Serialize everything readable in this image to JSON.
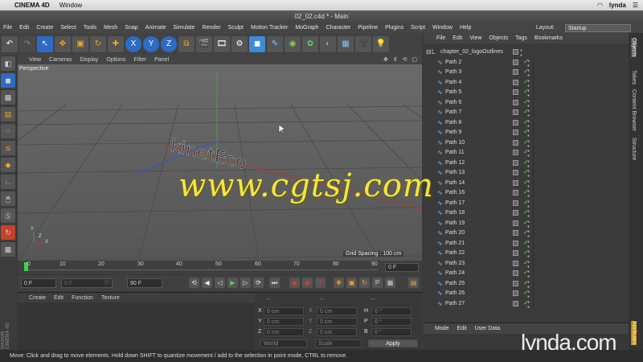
{
  "macmenu": {
    "app": "CINEMA 4D",
    "window": "Window",
    "user": "lynda"
  },
  "window_title": "02_02.c4d * - Main",
  "menubar": [
    "File",
    "Edit",
    "Create",
    "Select",
    "Tools",
    "Mesh",
    "Snap",
    "Animate",
    "Simulate",
    "Render",
    "Sculpt",
    "Motion Tracker",
    "MoGraph",
    "Character",
    "Pipeline",
    "Plugins",
    "Script",
    "Window",
    "Help"
  ],
  "layout": {
    "label": "Layout:",
    "value": "Startup"
  },
  "view_menu": [
    "View",
    "Cameras",
    "Display",
    "Options",
    "Filter",
    "Panel"
  ],
  "viewport": {
    "label": "Perspective",
    "grid_spacing": "Grid Spacing : 100 cm",
    "logo_text": "kinetEco"
  },
  "timeline": {
    "ticks": [
      "0",
      "10",
      "20",
      "30",
      "40",
      "50",
      "60",
      "70",
      "80",
      "90"
    ],
    "end_field": "0 F"
  },
  "transport": {
    "current": "0 F",
    "min": "0 F",
    "min_val": "90 F",
    "max": "90 F"
  },
  "material_menu": [
    "Create",
    "Edit",
    "Function",
    "Texture"
  ],
  "coords": {
    "headers": [
      "--",
      "--",
      "--"
    ],
    "rows": [
      {
        "axis": "X",
        "pos": "0 cm",
        "size": "0 cm",
        "rlabel": "H",
        "rot": "0 °"
      },
      {
        "axis": "Y",
        "pos": "0 cm",
        "size": "0 cm",
        "rlabel": "P",
        "rot": "0 °"
      },
      {
        "axis": "Z",
        "pos": "0 cm",
        "size": "0 cm",
        "rlabel": "B",
        "rot": "0 °"
      }
    ],
    "world": "World",
    "scale": "Scale",
    "apply": "Apply"
  },
  "objects": {
    "menu": [
      "File",
      "Edit",
      "View",
      "Objects",
      "Tags",
      "Bookmarks"
    ],
    "root": "chapter_02_logoOutlines",
    "items": [
      "Path 2",
      "Path 3",
      "Path 4",
      "Path 5",
      "Path 6",
      "Path 7",
      "Path 8",
      "Path 9",
      "Path 10",
      "Path 11",
      "Path 12",
      "Path 13",
      "Path 14",
      "Path 16",
      "Path 17",
      "Path 18",
      "Path 19",
      "Path 20",
      "Path 21",
      "Path 22",
      "Path 23",
      "Path 24",
      "Path 25",
      "Path 26",
      "Path 27"
    ]
  },
  "attributes_menu": [
    "Mode",
    "Edit",
    "User Data"
  ],
  "side_tabs": [
    "Objects",
    "Takes",
    "Content Browser",
    "Structure",
    "Attributes"
  ],
  "status": "Move: Click and drag to move elements. Hold down SHIFT to quantize movement / add to the selection in point mode, CTRL to remove.",
  "watermark": "www.cgtsj.com",
  "brand": "lynda.com",
  "maxon": "MAXON CINEMA 4D",
  "colors": {
    "accent_blue": "#3d7fd6",
    "check_green": "#6fd34a",
    "watermark": "#f5e53a"
  }
}
